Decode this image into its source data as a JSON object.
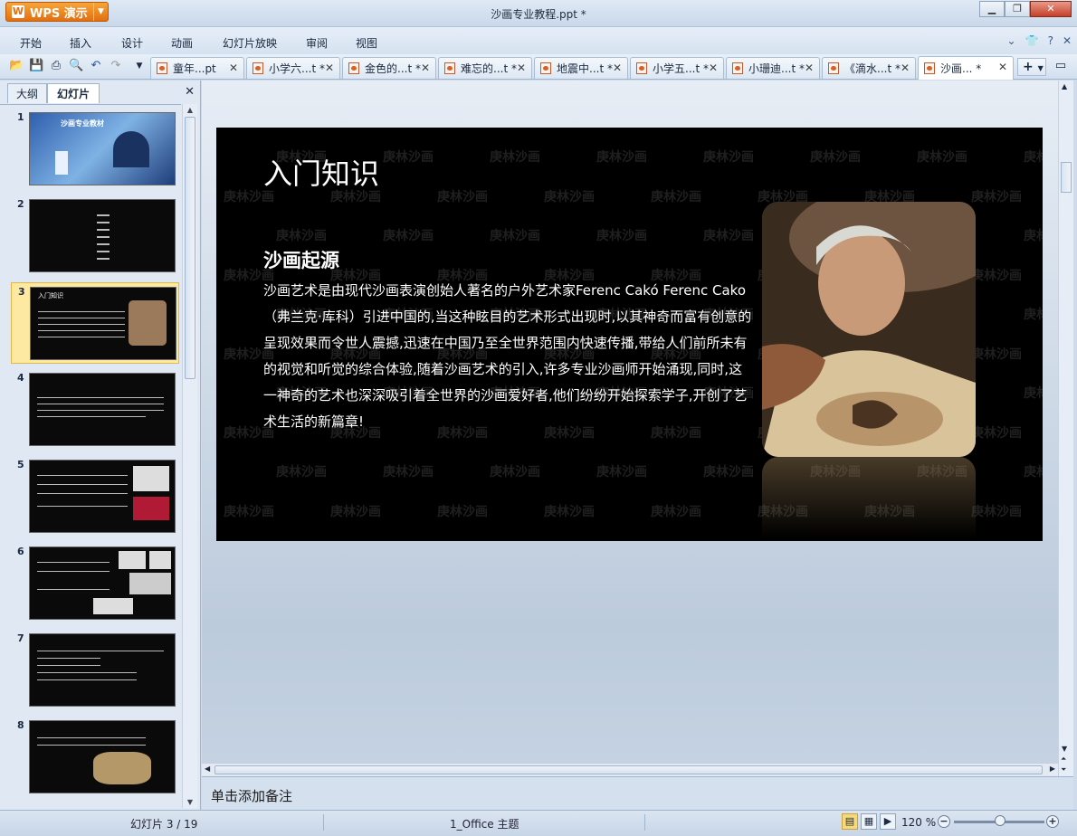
{
  "app": {
    "wps_label": "WPS 演示",
    "window_title": "沙画专业教程.ppt *"
  },
  "menu": [
    "开始",
    "插入",
    "设计",
    "动画",
    "幻灯片放映",
    "审阅",
    "视图"
  ],
  "tabs": [
    {
      "label": "童年...pt"
    },
    {
      "label": "小学六...t *"
    },
    {
      "label": "金色的...t *"
    },
    {
      "label": "难忘的...t *"
    },
    {
      "label": "地震中...t *"
    },
    {
      "label": "小学五...t *"
    },
    {
      "label": "小珊迪...t *"
    },
    {
      "label": "《滴水...t *"
    },
    {
      "label": "沙画... *"
    }
  ],
  "left_panel": {
    "tab_outline": "大纲",
    "tab_slides": "幻灯片",
    "thumbnails": [
      "1",
      "2",
      "3",
      "4",
      "5",
      "6",
      "7",
      "8"
    ],
    "thumb1_title": "沙画专业教材",
    "thumb3_title": "入门知识"
  },
  "slide": {
    "title": "入门知识",
    "heading": "沙画起源",
    "body": "沙画艺术是由现代沙画表演创始人著名的户外艺术家Ferenc Cakó Ferenc Cako （弗兰克·库科）引进中国的,当这种眩目的艺术形式出现时,以其神奇而富有创意的呈现效果而令世人震撼,迅速在中国乃至全世界范围内快速传播,带给人们前所未有的视觉和听觉的综合体验,随着沙画艺术的引入,许多专业沙画师开始涌现,同时,这一神奇的艺术也深深吸引着全世界的沙画爱好者,他们纷纷开始探索学子,开创了艺术生活的新篇章!",
    "watermark": "庚林沙画"
  },
  "notes_placeholder": "单击添加备注",
  "status": {
    "slide_counter": "幻灯片 3 / 19",
    "theme": "1_Office 主题",
    "zoom": "120 %"
  },
  "colors": {
    "accent": "#e26f10",
    "slide_bg": "#000000",
    "selection": "#fde9a2"
  }
}
